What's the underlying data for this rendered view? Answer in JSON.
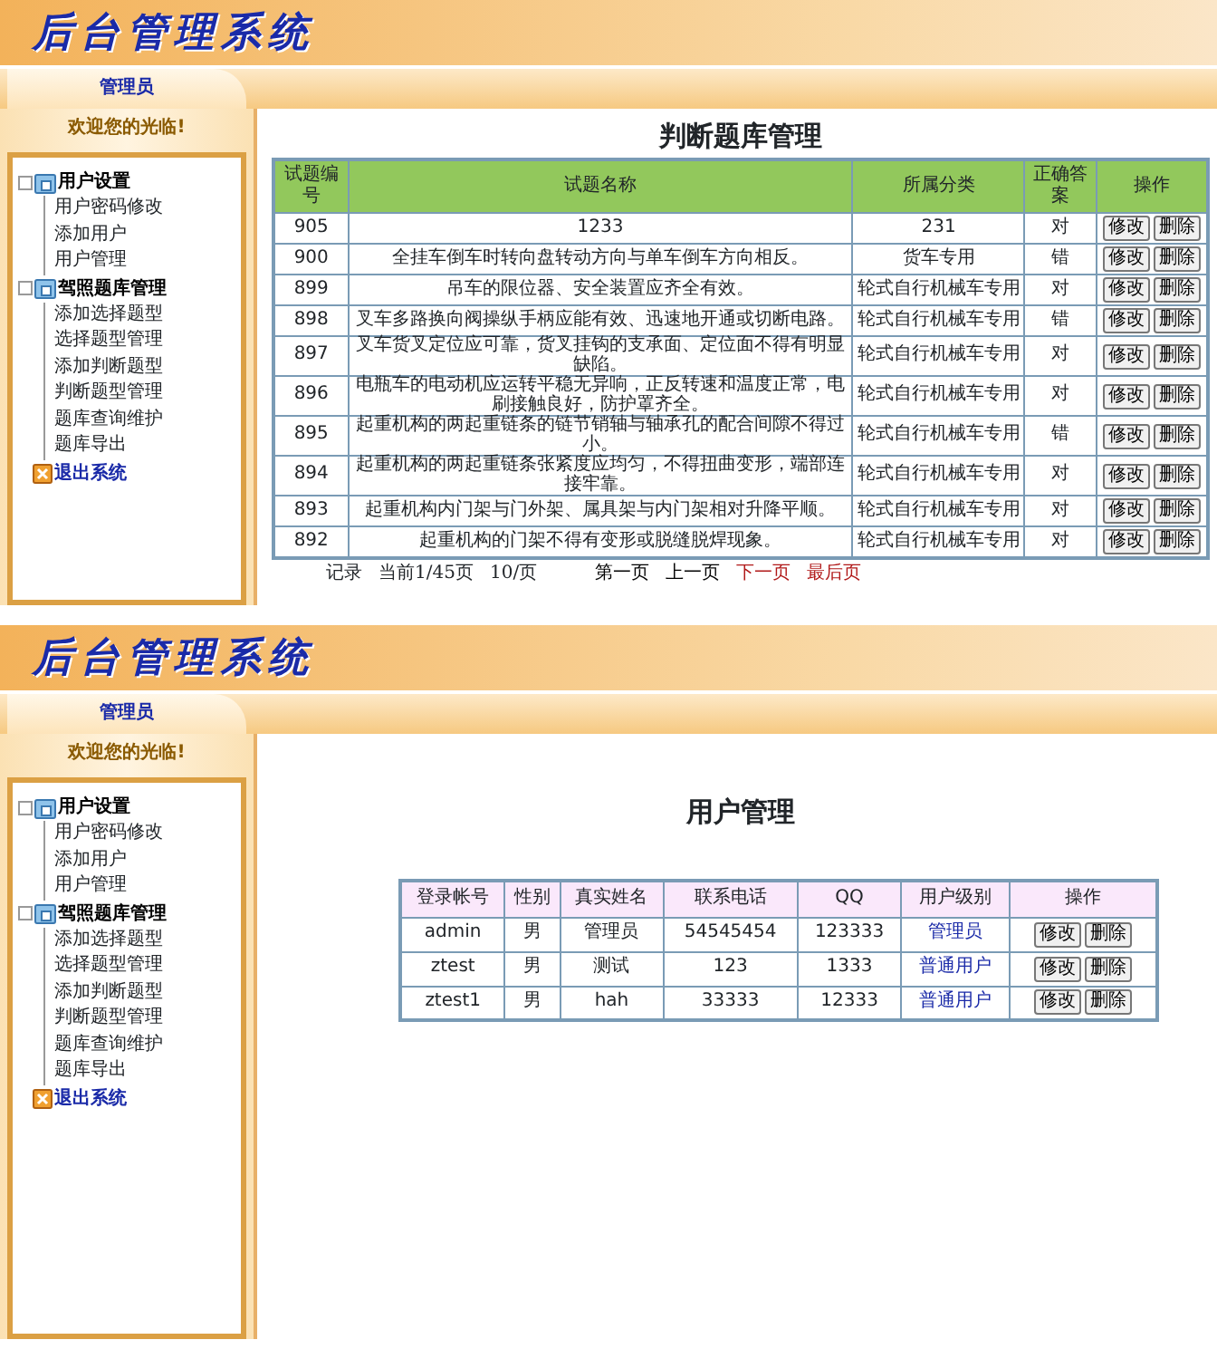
{
  "screens": [
    {
      "kind": "questions",
      "header": {
        "title": "后台管理系统"
      },
      "sidebar": {
        "tab": "管理员",
        "welcome": "欢迎您的光临!",
        "groups": [
          {
            "title": "用户设置",
            "expanded": true,
            "children": [
              "用户密码修改",
              "添加用户",
              "用户管理"
            ]
          },
          {
            "title": "驾照题库管理",
            "expanded": true,
            "children": [
              "添加选择题型",
              "选择题型管理",
              "添加判断题型",
              "判断题型管理",
              "题库查询维护",
              "题库导出"
            ]
          }
        ],
        "exit": "退出系统"
      },
      "content": {
        "title": "判断题库管理",
        "columns": [
          "试题编号",
          "试题名称",
          "所属分类",
          "正确答案",
          "操作"
        ],
        "rows": [
          {
            "cells": [
              "905",
              "1233",
              "231",
              "对"
            ],
            "actions": [
              "修改",
              "删除"
            ]
          },
          {
            "cells": [
              "900",
              "全挂车倒车时转向盘转动方向与单车倒车方向相反。",
              "货车专用",
              "错"
            ],
            "actions": [
              "修改",
              "删除"
            ]
          },
          {
            "cells": [
              "899",
              "吊车的限位器、安全装置应齐全有效。",
              "轮式自行机械车专用",
              "对"
            ],
            "actions": [
              "修改",
              "删除"
            ]
          },
          {
            "cells": [
              "898",
              "叉车多路换向阀操纵手柄应能有效、迅速地开通或切断电路。",
              "轮式自行机械车专用",
              "错"
            ],
            "actions": [
              "修改",
              "删除"
            ]
          },
          {
            "cells": [
              "897",
              "叉车货叉定位应可靠，货叉挂钩的支承面、定位面不得有明显缺陷。",
              "轮式自行机械车专用",
              "对"
            ],
            "actions": [
              "修改",
              "删除"
            ]
          },
          {
            "cells": [
              "896",
              "电瓶车的电动机应运转平稳无异响，正反转速和温度正常，电刷接触良好，防护罩齐全。",
              "轮式自行机械车专用",
              "对"
            ],
            "actions": [
              "修改",
              "删除"
            ]
          },
          {
            "cells": [
              "895",
              "起重机构的两起重链条的链节销轴与轴承孔的配合间隙不得过小。",
              "轮式自行机械车专用",
              "错"
            ],
            "actions": [
              "修改",
              "删除"
            ]
          },
          {
            "cells": [
              "894",
              "起重机构的两起重链条张紧度应均匀，不得扭曲变形，端部连接牢靠。",
              "轮式自行机械车专用",
              "对"
            ],
            "actions": [
              "修改",
              "删除"
            ]
          },
          {
            "cells": [
              "893",
              "起重机构内门架与门外架、属具架与内门架相对升降平顺。",
              "轮式自行机械车专用",
              "对"
            ],
            "actions": [
              "修改",
              "删除"
            ]
          },
          {
            "cells": [
              "892",
              "起重机构的门架不得有变形或脱缝脱焊现象。",
              "轮式自行机械车专用",
              "对"
            ],
            "actions": [
              "修改",
              "删除"
            ]
          }
        ],
        "pager": {
          "info": [
            "记录",
            "当前1/45页",
            "10/页"
          ],
          "links": [
            {
              "label": "第一页",
              "disabled": true
            },
            {
              "label": "上一页",
              "disabled": true
            },
            {
              "label": "下一页",
              "disabled": false
            },
            {
              "label": "最后页",
              "disabled": false
            }
          ]
        }
      }
    },
    {
      "kind": "users",
      "header": {
        "title": "后台管理系统"
      },
      "sidebar": {
        "tab": "管理员",
        "welcome": "欢迎您的光临!",
        "groups": [
          {
            "title": "用户设置",
            "expanded": true,
            "children": [
              "用户密码修改",
              "添加用户",
              "用户管理"
            ]
          },
          {
            "title": "驾照题库管理",
            "expanded": true,
            "children": [
              "添加选择题型",
              "选择题型管理",
              "添加判断题型",
              "判断题型管理",
              "题库查询维护",
              "题库导出"
            ]
          }
        ],
        "exit": "退出系统"
      },
      "content": {
        "title": "用户管理",
        "columns": [
          "登录帐号",
          "性别",
          "真实姓名",
          "联系电话",
          "QQ",
          "用户级别",
          "操作"
        ],
        "rows": [
          {
            "cells": [
              "admin",
              "男",
              "管理员",
              "54545454",
              "123333",
              "管理员"
            ],
            "actions": [
              "修改",
              "删除"
            ]
          },
          {
            "cells": [
              "ztest",
              "男",
              "测试",
              "123",
              "1333",
              "普通用户"
            ],
            "actions": [
              "修改",
              "删除"
            ]
          },
          {
            "cells": [
              "ztest1",
              "男",
              "hah",
              "33333",
              "12333",
              "普通用户"
            ],
            "actions": [
              "修改",
              "删除"
            ]
          }
        ]
      }
    }
  ]
}
